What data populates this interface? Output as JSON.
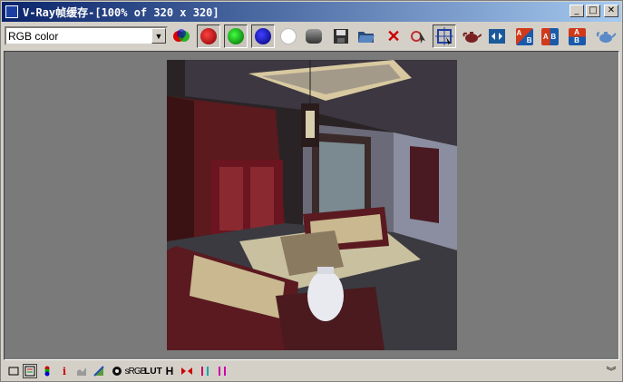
{
  "window": {
    "title": "V-Ray帧缓存-[100% of 320 x 320]",
    "minimize": "_",
    "maximize": "□",
    "close": "✕"
  },
  "toolbar": {
    "channel": {
      "selected": "RGB color",
      "arrow": "▼"
    },
    "buttons": [
      {
        "name": "rgb-channels-icon",
        "kind": "rgb"
      },
      {
        "name": "red-channel-icon",
        "color": "#cc0000"
      },
      {
        "name": "green-channel-icon",
        "color": "#00aa00"
      },
      {
        "name": "blue-channel-icon",
        "color": "#0000aa"
      },
      {
        "name": "alpha-channel-icon",
        "color": "#ffffff"
      },
      {
        "name": "monochrome-icon",
        "color": "#555555"
      },
      {
        "name": "save-icon"
      },
      {
        "name": "open-icon"
      },
      {
        "name": "clear-icon",
        "glyph": "✕"
      },
      {
        "name": "track-mouse-icon"
      },
      {
        "name": "region-render-icon"
      },
      {
        "name": "render-last-icon"
      },
      {
        "name": "compare-ab-icon"
      },
      {
        "name": "swap-ab-horizontal-icon",
        "label_a": "A",
        "label_b": "B"
      },
      {
        "name": "swap-ab-icon",
        "label_a": "A",
        "label_b": "B"
      },
      {
        "name": "swap-ab-vertical-icon",
        "label_a": "A",
        "label_b": "B"
      },
      {
        "name": "teapot-render-icon"
      }
    ]
  },
  "statusbar": {
    "items": [
      {
        "name": "display-icon"
      },
      {
        "name": "history-icon"
      },
      {
        "name": "layers-icon"
      },
      {
        "name": "info-icon",
        "text": "i"
      },
      {
        "name": "levels-icon"
      },
      {
        "name": "curve-icon"
      },
      {
        "name": "exposure-icon"
      },
      {
        "name": "srgb-label",
        "text": "sRGB"
      },
      {
        "name": "lut-label",
        "text": "LUT"
      },
      {
        "name": "histogram-label",
        "text": "H"
      },
      {
        "name": "stereo-icon"
      },
      {
        "name": "pixel-aspect-icon"
      },
      {
        "name": "ocio-icon"
      }
    ],
    "expand": "︾"
  }
}
